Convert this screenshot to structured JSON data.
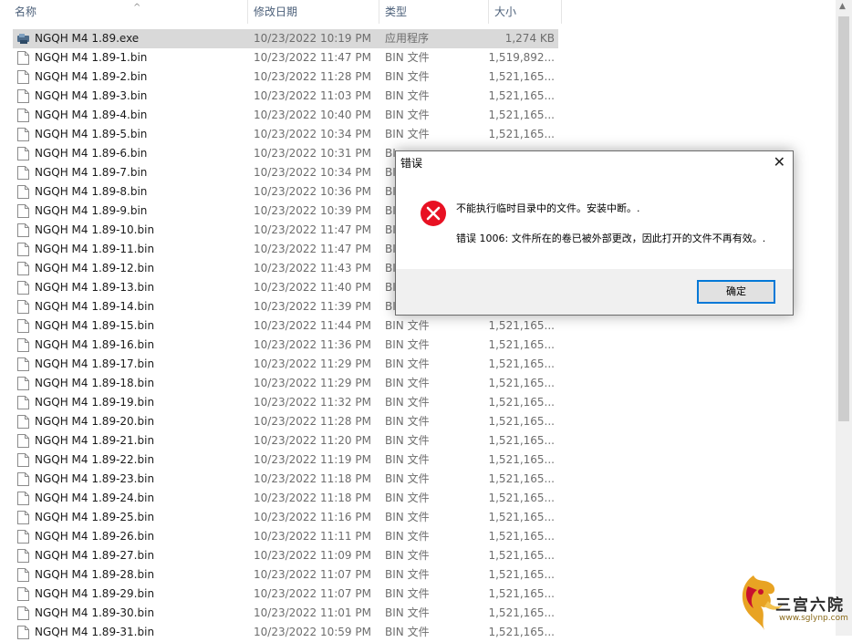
{
  "columns": {
    "name": "名称",
    "date": "修改日期",
    "type": "类型",
    "size": "大小"
  },
  "files": [
    {
      "name": "NGQH M4 1.89.exe",
      "date": "10/23/2022 10:19 PM",
      "type": "应用程序",
      "size": "1,274 KB",
      "icon": "app-icon",
      "selected": true
    },
    {
      "name": "NGQH M4 1.89-1.bin",
      "date": "10/23/2022 11:47 PM",
      "type": "BIN 文件",
      "size": "1,519,892...",
      "icon": "file-icon"
    },
    {
      "name": "NGQH M4 1.89-2.bin",
      "date": "10/23/2022 11:28 PM",
      "type": "BIN 文件",
      "size": "1,521,165...",
      "icon": "file-icon"
    },
    {
      "name": "NGQH M4 1.89-3.bin",
      "date": "10/23/2022 11:03 PM",
      "type": "BIN 文件",
      "size": "1,521,165...",
      "icon": "file-icon"
    },
    {
      "name": "NGQH M4 1.89-4.bin",
      "date": "10/23/2022 10:40 PM",
      "type": "BIN 文件",
      "size": "1,521,165...",
      "icon": "file-icon"
    },
    {
      "name": "NGQH M4 1.89-5.bin",
      "date": "10/23/2022 10:34 PM",
      "type": "BIN 文件",
      "size": "1,521,165...",
      "icon": "file-icon"
    },
    {
      "name": "NGQH M4 1.89-6.bin",
      "date": "10/23/2022 10:31 PM",
      "type": "BI",
      "size": "",
      "icon": "file-icon"
    },
    {
      "name": "NGQH M4 1.89-7.bin",
      "date": "10/23/2022 10:34 PM",
      "type": "BI",
      "size": "",
      "icon": "file-icon"
    },
    {
      "name": "NGQH M4 1.89-8.bin",
      "date": "10/23/2022 10:36 PM",
      "type": "BI",
      "size": "",
      "icon": "file-icon"
    },
    {
      "name": "NGQH M4 1.89-9.bin",
      "date": "10/23/2022 10:39 PM",
      "type": "BI",
      "size": "",
      "icon": "file-icon"
    },
    {
      "name": "NGQH M4 1.89-10.bin",
      "date": "10/23/2022 11:47 PM",
      "type": "BI",
      "size": "",
      "icon": "file-icon"
    },
    {
      "name": "NGQH M4 1.89-11.bin",
      "date": "10/23/2022 11:47 PM",
      "type": "BI",
      "size": "",
      "icon": "file-icon"
    },
    {
      "name": "NGQH M4 1.89-12.bin",
      "date": "10/23/2022 11:43 PM",
      "type": "BI",
      "size": "",
      "icon": "file-icon"
    },
    {
      "name": "NGQH M4 1.89-13.bin",
      "date": "10/23/2022 11:40 PM",
      "type": "BI",
      "size": "",
      "icon": "file-icon"
    },
    {
      "name": "NGQH M4 1.89-14.bin",
      "date": "10/23/2022 11:39 PM",
      "type": "BI",
      "size": "",
      "icon": "file-icon"
    },
    {
      "name": "NGQH M4 1.89-15.bin",
      "date": "10/23/2022 11:44 PM",
      "type": "BIN 文件",
      "size": "1,521,165...",
      "icon": "file-icon"
    },
    {
      "name": "NGQH M4 1.89-16.bin",
      "date": "10/23/2022 11:36 PM",
      "type": "BIN 文件",
      "size": "1,521,165...",
      "icon": "file-icon"
    },
    {
      "name": "NGQH M4 1.89-17.bin",
      "date": "10/23/2022 11:29 PM",
      "type": "BIN 文件",
      "size": "1,521,165...",
      "icon": "file-icon"
    },
    {
      "name": "NGQH M4 1.89-18.bin",
      "date": "10/23/2022 11:29 PM",
      "type": "BIN 文件",
      "size": "1,521,165...",
      "icon": "file-icon"
    },
    {
      "name": "NGQH M4 1.89-19.bin",
      "date": "10/23/2022 11:32 PM",
      "type": "BIN 文件",
      "size": "1,521,165...",
      "icon": "file-icon"
    },
    {
      "name": "NGQH M4 1.89-20.bin",
      "date": "10/23/2022 11:28 PM",
      "type": "BIN 文件",
      "size": "1,521,165...",
      "icon": "file-icon"
    },
    {
      "name": "NGQH M4 1.89-21.bin",
      "date": "10/23/2022 11:20 PM",
      "type": "BIN 文件",
      "size": "1,521,165...",
      "icon": "file-icon"
    },
    {
      "name": "NGQH M4 1.89-22.bin",
      "date": "10/23/2022 11:19 PM",
      "type": "BIN 文件",
      "size": "1,521,165...",
      "icon": "file-icon"
    },
    {
      "name": "NGQH M4 1.89-23.bin",
      "date": "10/23/2022 11:18 PM",
      "type": "BIN 文件",
      "size": "1,521,165...",
      "icon": "file-icon"
    },
    {
      "name": "NGQH M4 1.89-24.bin",
      "date": "10/23/2022 11:18 PM",
      "type": "BIN 文件",
      "size": "1,521,165...",
      "icon": "file-icon"
    },
    {
      "name": "NGQH M4 1.89-25.bin",
      "date": "10/23/2022 11:16 PM",
      "type": "BIN 文件",
      "size": "1,521,165...",
      "icon": "file-icon"
    },
    {
      "name": "NGQH M4 1.89-26.bin",
      "date": "10/23/2022 11:11 PM",
      "type": "BIN 文件",
      "size": "1,521,165...",
      "icon": "file-icon"
    },
    {
      "name": "NGQH M4 1.89-27.bin",
      "date": "10/23/2022 11:09 PM",
      "type": "BIN 文件",
      "size": "1,521,165...",
      "icon": "file-icon"
    },
    {
      "name": "NGQH M4 1.89-28.bin",
      "date": "10/23/2022 11:07 PM",
      "type": "BIN 文件",
      "size": "1,521,165...",
      "icon": "file-icon"
    },
    {
      "name": "NGQH M4 1.89-29.bin",
      "date": "10/23/2022 11:07 PM",
      "type": "BIN 文件",
      "size": "1,521,165...",
      "icon": "file-icon"
    },
    {
      "name": "NGQH M4 1.89-30.bin",
      "date": "10/23/2022 11:01 PM",
      "type": "BIN 文件",
      "size": "1,521,165...",
      "icon": "file-icon"
    },
    {
      "name": "NGQH M4 1.89-31.bin",
      "date": "10/23/2022 10:59 PM",
      "type": "BIN 文件",
      "size": "1,521,165...",
      "icon": "file-icon"
    }
  ],
  "dialog": {
    "title": "错误",
    "message": "不能执行临时目录中的文件。安装中断。.",
    "detail": "错误 1006: 文件所在的卷已被外部更改，因此打开的文件不再有效。.",
    "ok_label": "确定",
    "icon": "error-icon",
    "close_icon": "close-icon"
  },
  "watermark": {
    "title": "三宫六院",
    "url": "www.sglynp.com"
  },
  "colors": {
    "selected_row": "#d9d9d9",
    "header_text": "#4c607a",
    "error_red": "#e81123",
    "button_border": "#0078d7"
  }
}
